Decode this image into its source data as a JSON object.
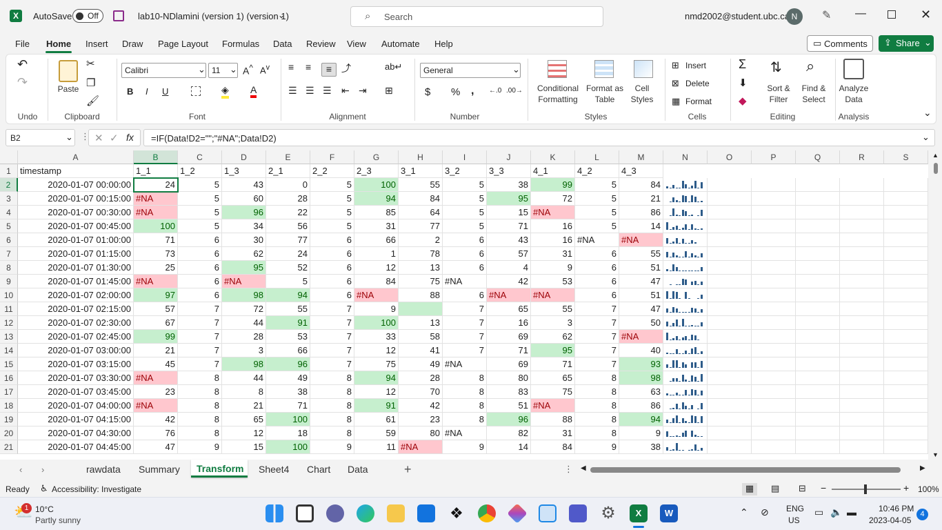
{
  "titlebar": {
    "app_icon": "excel-icon",
    "autosave_label": "AutoSave",
    "autosave_state": "Off",
    "save_icon": "save-icon",
    "document_title": "lab10-NDlamini (version 1) (version 1)",
    "search_placeholder": "Search",
    "account": "nmd2002@student.ubc.ca",
    "avatar_initial": "N"
  },
  "menu": {
    "items": [
      "File",
      "Home",
      "Insert",
      "Draw",
      "Page Layout",
      "Formulas",
      "Data",
      "Review",
      "View",
      "Automate",
      "Help"
    ],
    "active": "Home",
    "comments_label": "Comments",
    "share_label": "Share"
  },
  "ribbon": {
    "undo_group": "Undo",
    "clipboard_group": "Clipboard",
    "paste_label": "Paste",
    "font_group": "Font",
    "font_name": "Calibri",
    "font_size": "11",
    "alignment_group": "Alignment",
    "number_group": "Number",
    "number_format": "General",
    "styles_group": "Styles",
    "conditional_formatting": "Conditional Formatting",
    "format_as_table": "Format as Table",
    "cell_styles": "Cell Styles",
    "cells_group": "Cells",
    "insert_label": "Insert",
    "delete_label": "Delete",
    "format_label": "Format",
    "editing_group": "Editing",
    "sort_filter": "Sort & Filter",
    "find_select": "Find & Select",
    "analysis_group": "Analysis",
    "analyze_data": "Analyze Data"
  },
  "formula_bar": {
    "name_box": "B2",
    "formula": "=IF(Data!D2=\"\";\"#NA\";Data!D2)"
  },
  "columns": [
    "A",
    "B",
    "C",
    "D",
    "E",
    "F",
    "G",
    "H",
    "I",
    "J",
    "K",
    "L",
    "M",
    "N",
    "O",
    "P",
    "Q",
    "R",
    "S"
  ],
  "header_row": [
    "timestamp",
    "1_1",
    "1_2",
    "1_3",
    "2_1",
    "2_2",
    "2_3",
    "3_1",
    "3_2",
    "3_3",
    "4_1",
    "4_2",
    "4_3"
  ],
  "rows": [
    {
      "n": "2",
      "cells": [
        "2020-01-07 00:00:00",
        "24",
        "5",
        "43",
        "0",
        "5",
        "100",
        "55",
        "5",
        "38",
        "99",
        "5",
        "84"
      ]
    },
    {
      "n": "3",
      "cells": [
        "2020-01-07 00:15:00",
        "#NA",
        "5",
        "60",
        "28",
        "5",
        "94",
        "84",
        "5",
        "95",
        "72",
        "5",
        "21"
      ]
    },
    {
      "n": "4",
      "cells": [
        "2020-01-07 00:30:00",
        "#NA",
        "5",
        "96",
        "22",
        "5",
        "85",
        "64",
        "5",
        "15",
        "#NA",
        "5",
        "86"
      ]
    },
    {
      "n": "5",
      "cells": [
        "2020-01-07 00:45:00",
        "100",
        "5",
        "34",
        "56",
        "5",
        "31",
        "77",
        "5",
        "71",
        "16",
        "5",
        "14"
      ]
    },
    {
      "n": "6",
      "cells": [
        "2020-01-07 01:00:00",
        "71",
        "6",
        "30",
        "77",
        "6",
        "66",
        "2",
        "6",
        "43",
        "16",
        "#NA",
        "#NA"
      ]
    },
    {
      "n": "7",
      "cells": [
        "2020-01-07 01:15:00",
        "73",
        "6",
        "62",
        "24",
        "6",
        "1",
        "78",
        "6",
        "57",
        "31",
        "6",
        "55"
      ]
    },
    {
      "n": "8",
      "cells": [
        "2020-01-07 01:30:00",
        "25",
        "6",
        "95",
        "52",
        "6",
        "12",
        "13",
        "6",
        "4",
        "9",
        "6",
        "51"
      ]
    },
    {
      "n": "9",
      "cells": [
        "2020-01-07 01:45:00",
        "#NA",
        "6",
        "#NA",
        "5",
        "6",
        "84",
        "75",
        "#NA",
        "42",
        "53",
        "6",
        "47"
      ]
    },
    {
      "n": "10",
      "cells": [
        "2020-01-07 02:00:00",
        "97",
        "6",
        "98",
        "94",
        "6",
        "#NA",
        "88",
        "6",
        "#NA",
        "#NA",
        "6",
        "51"
      ]
    },
    {
      "n": "11",
      "cells": [
        "2020-01-07 02:15:00",
        "57",
        "7",
        "72",
        "55",
        "7",
        "9",
        "",
        "7",
        "65",
        "55",
        "7",
        "47"
      ]
    },
    {
      "n": "12",
      "cells": [
        "2020-01-07 02:30:00",
        "67",
        "7",
        "44",
        "91",
        "7",
        "100",
        "13",
        "7",
        "16",
        "3",
        "7",
        "50"
      ]
    },
    {
      "n": "13",
      "cells": [
        "2020-01-07 02:45:00",
        "99",
        "7",
        "28",
        "53",
        "7",
        "33",
        "58",
        "7",
        "69",
        "62",
        "7",
        "#NA"
      ]
    },
    {
      "n": "14",
      "cells": [
        "2020-01-07 03:00:00",
        "21",
        "7",
        "3",
        "66",
        "7",
        "12",
        "41",
        "7",
        "71",
        "95",
        "7",
        "40"
      ]
    },
    {
      "n": "15",
      "cells": [
        "2020-01-07 03:15:00",
        "45",
        "7",
        "98",
        "96",
        "7",
        "75",
        "49",
        "#NA",
        "69",
        "71",
        "7",
        "93"
      ]
    },
    {
      "n": "16",
      "cells": [
        "2020-01-07 03:30:00",
        "#NA",
        "8",
        "44",
        "49",
        "8",
        "94",
        "28",
        "8",
        "80",
        "65",
        "8",
        "98"
      ]
    },
    {
      "n": "17",
      "cells": [
        "2020-01-07 03:45:00",
        "23",
        "8",
        "8",
        "38",
        "8",
        "12",
        "70",
        "8",
        "83",
        "75",
        "8",
        "63"
      ]
    },
    {
      "n": "18",
      "cells": [
        "2020-01-07 04:00:00",
        "#NA",
        "8",
        "21",
        "71",
        "8",
        "91",
        "42",
        "8",
        "51",
        "#NA",
        "8",
        "86"
      ]
    },
    {
      "n": "19",
      "cells": [
        "2020-01-07 04:15:00",
        "42",
        "8",
        "65",
        "100",
        "8",
        "61",
        "23",
        "8",
        "96",
        "88",
        "8",
        "94"
      ]
    },
    {
      "n": "20",
      "cells": [
        "2020-01-07 04:30:00",
        "76",
        "8",
        "12",
        "18",
        "8",
        "59",
        "80",
        "#NA",
        "82",
        "31",
        "8",
        "9"
      ]
    },
    {
      "n": "21",
      "cells": [
        "2020-01-07 04:45:00",
        "47",
        "9",
        "15",
        "100",
        "9",
        "11",
        "#NA",
        "9",
        "14",
        "84",
        "9",
        "38"
      ]
    }
  ],
  "sheet_tabs": [
    "rawdata",
    "Summary",
    "Transform",
    "Sheet4",
    "Chart",
    "Data"
  ],
  "active_sheet": "Transform",
  "status": {
    "ready": "Ready",
    "accessibility": "Accessibility: Investigate",
    "zoom": "100%"
  },
  "taskbar": {
    "weather_temp": "10°C",
    "weather_desc": "Partly sunny",
    "weather_badge": "1",
    "lang1": "ENG",
    "lang2": "US",
    "time": "10:46 PM",
    "date": "2023-04-05",
    "notif_count": "4"
  },
  "colors": {
    "excel_green": "#107c41",
    "good_fill": "#c6efce",
    "bad_fill": "#ffc7ce",
    "spark": "#2e5c8a"
  }
}
